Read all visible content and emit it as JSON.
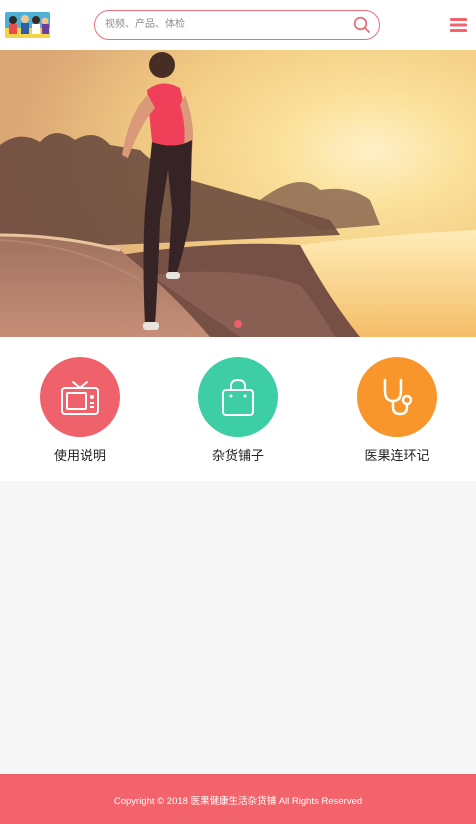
{
  "header": {
    "search": {
      "placeholder": "视频、产品、体检",
      "value": ""
    },
    "search_icon": "search-icon",
    "menu_icon": "hamburger-menu-icon"
  },
  "banner": {
    "slides": 1,
    "active_slide": 1,
    "image_subject": "woman running along waterfront at sunset"
  },
  "quick_links": [
    {
      "label": "使用说明",
      "icon": "tv-icon",
      "color": "#ef626c"
    },
    {
      "label": "杂货铺子",
      "icon": "shopping-bag-icon",
      "color": "#3dcea5"
    },
    {
      "label": "医果连环记",
      "icon": "stethoscope-icon",
      "color": "#f9962b"
    }
  ],
  "footer": {
    "copyright": "Copyright © 2018 医果健康生活杂货铺 All Rights Reserved"
  },
  "colors": {
    "accent": "#f2636b",
    "search_border": "#e8707a",
    "background": "#f7f7f7"
  }
}
